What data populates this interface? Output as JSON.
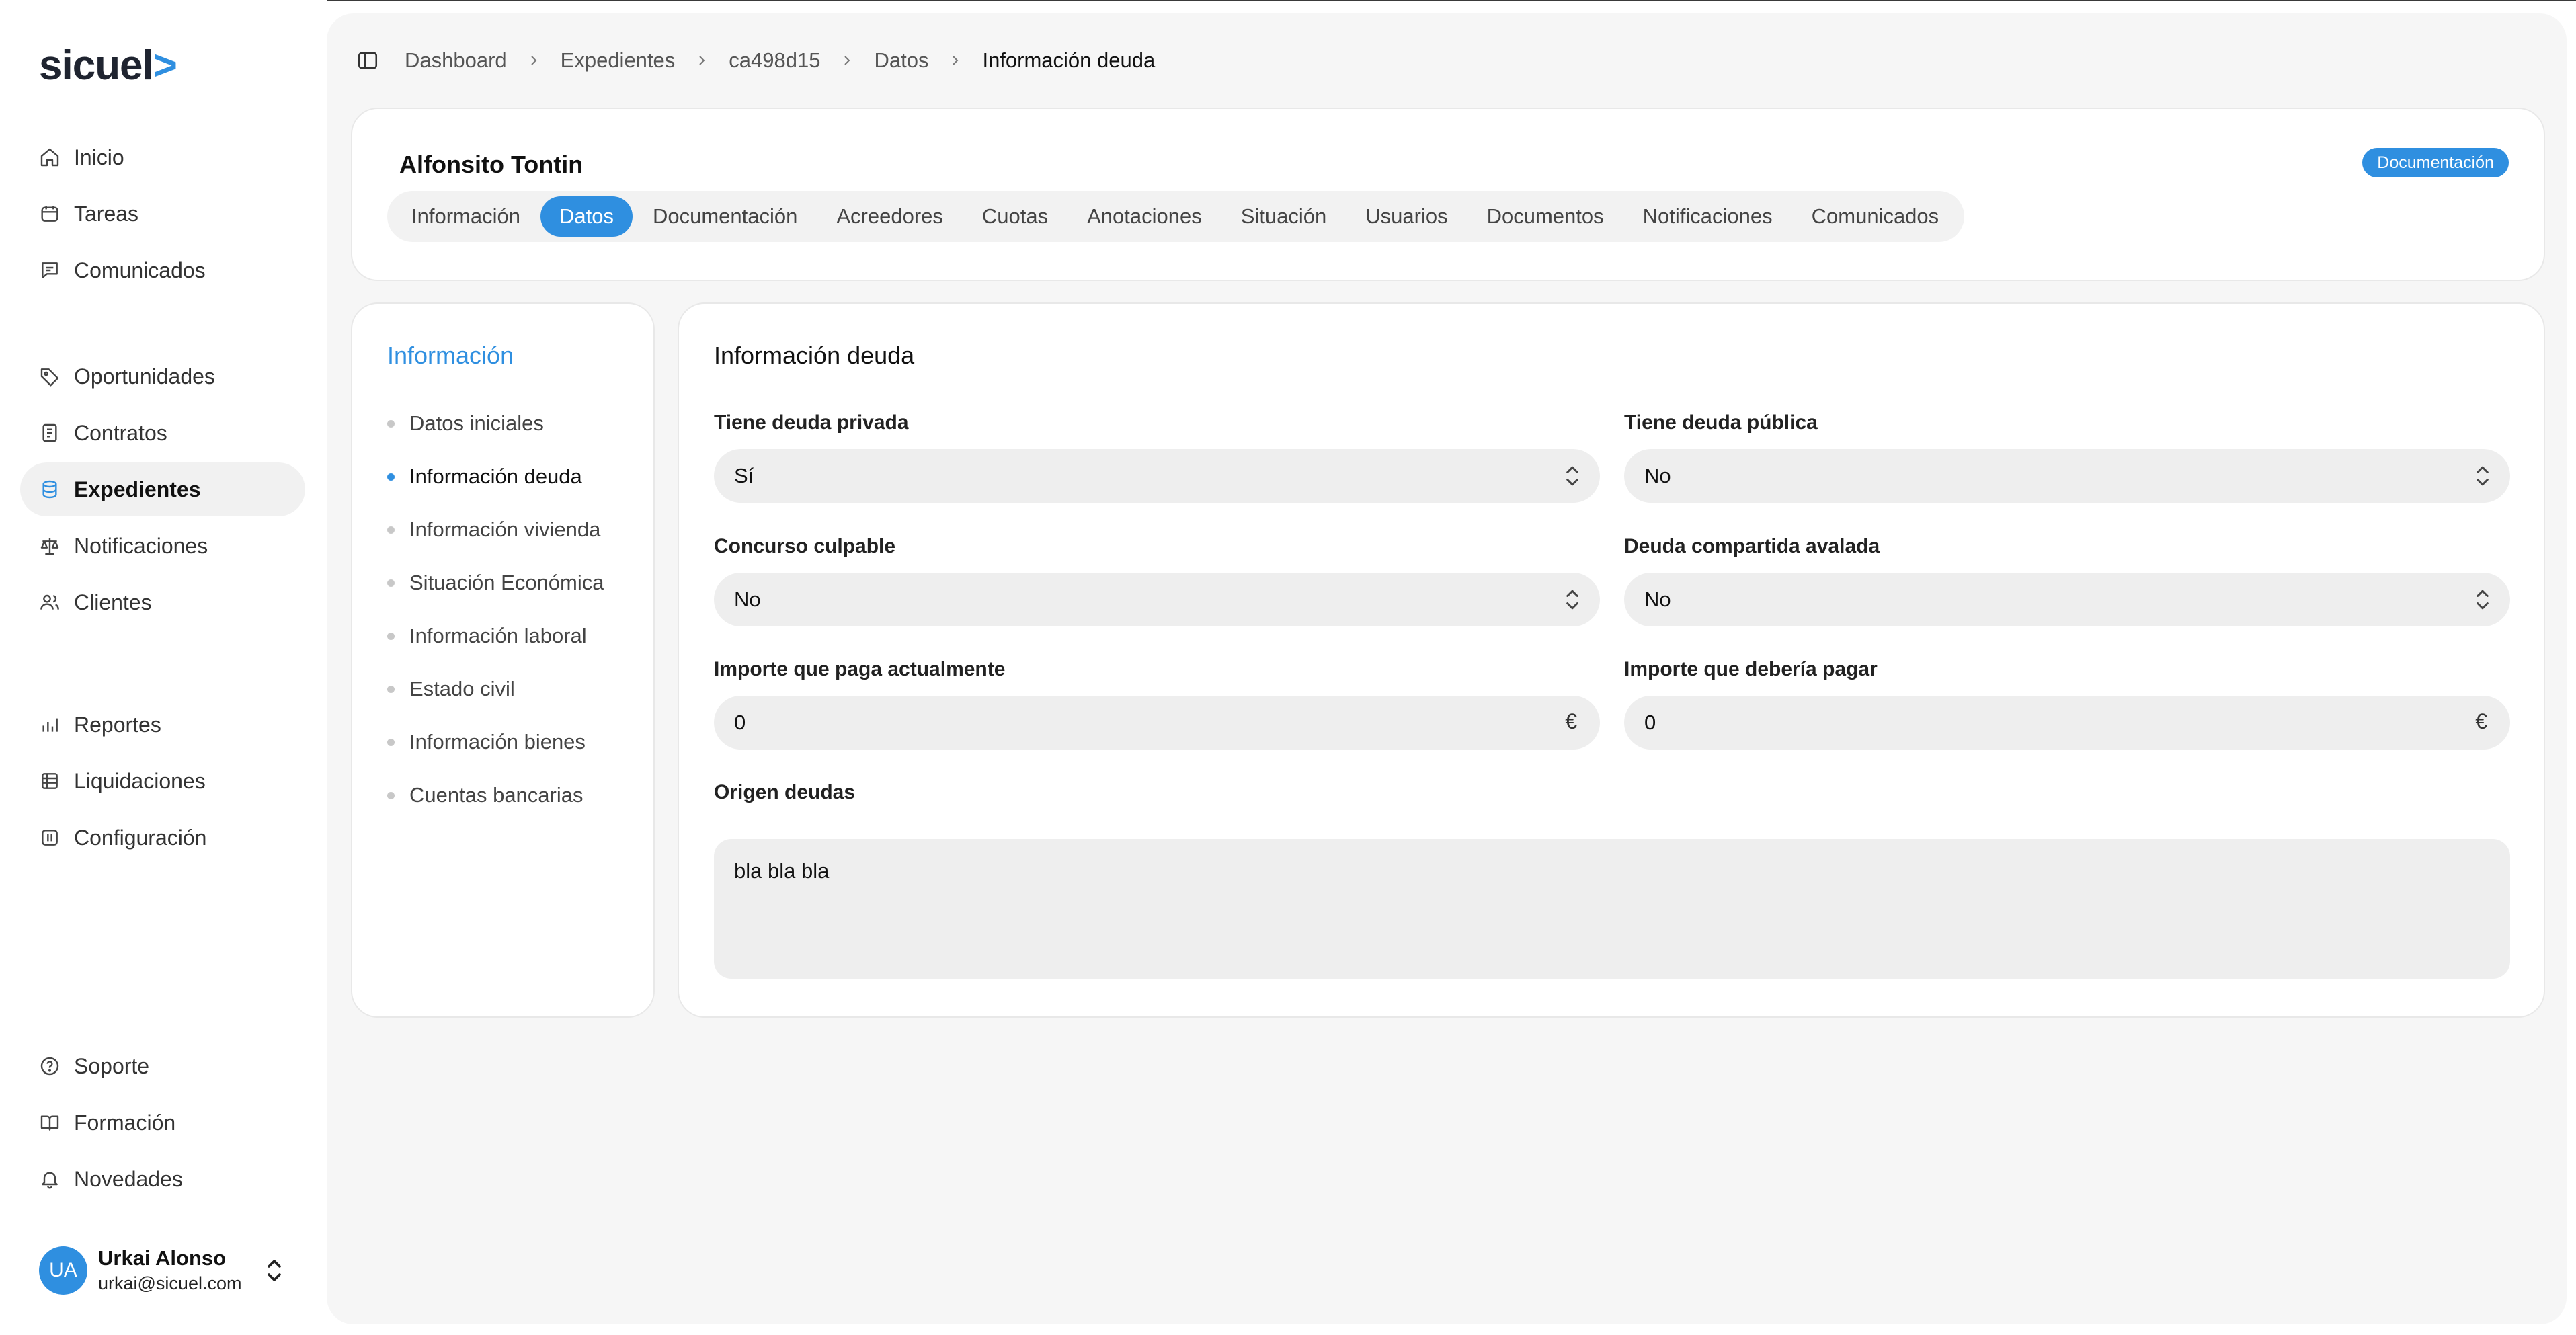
{
  "logo": {
    "text": "sicuel",
    "mark": ">"
  },
  "sidebar": {
    "group1": [
      {
        "label": "Inicio",
        "icon": "home-icon"
      },
      {
        "label": "Tareas",
        "icon": "calendar-icon"
      },
      {
        "label": "Comunicados",
        "icon": "message-icon"
      }
    ],
    "group2": [
      {
        "label": "Oportunidades",
        "icon": "tag-icon"
      },
      {
        "label": "Contratos",
        "icon": "contract-icon"
      },
      {
        "label": "Expedientes",
        "icon": "database-icon",
        "active": true
      },
      {
        "label": "Notificaciones",
        "icon": "scale-icon"
      },
      {
        "label": "Clientes",
        "icon": "users-icon"
      }
    ],
    "group3": [
      {
        "label": "Reportes",
        "icon": "chart-icon"
      },
      {
        "label": "Liquidaciones",
        "icon": "stack-icon"
      },
      {
        "label": "Configuración",
        "icon": "settings-icon"
      }
    ],
    "group4": [
      {
        "label": "Soporte",
        "icon": "help-icon"
      },
      {
        "label": "Formación",
        "icon": "book-icon"
      },
      {
        "label": "Novedades",
        "icon": "bell-icon"
      }
    ]
  },
  "user": {
    "initials": "UA",
    "name": "Urkai Alonso",
    "email": "urkai@sicuel.com"
  },
  "breadcrumb": [
    "Dashboard",
    "Expedientes",
    "ca498d15",
    "Datos",
    "Información deuda"
  ],
  "header": {
    "name": "Alfonsito Tontin",
    "badge": "Documentación",
    "tabs": [
      "Información",
      "Datos",
      "Documentación",
      "Acreedores",
      "Cuotas",
      "Anotaciones",
      "Situación",
      "Usuarios",
      "Documentos",
      "Notificaciones",
      "Comunicados"
    ],
    "active_tab": "Datos"
  },
  "section_nav": {
    "title": "Información",
    "items": [
      "Datos iniciales",
      "Información deuda",
      "Información vivienda",
      "Situación Económica",
      "Información laboral",
      "Estado civil",
      "Información bienes",
      "Cuentas bancarias"
    ],
    "active": "Información deuda"
  },
  "form": {
    "title": "Información deuda",
    "tiene_deuda_privada": {
      "label": "Tiene deuda privada",
      "value": "Sí"
    },
    "tiene_deuda_publica": {
      "label": "Tiene deuda pública",
      "value": "No"
    },
    "concurso_culpable": {
      "label": "Concurso culpable",
      "value": "No"
    },
    "deuda_compartida": {
      "label": "Deuda compartida avalada",
      "value": "No"
    },
    "importe_paga": {
      "label": "Importe que paga actualmente",
      "value": "0",
      "unit": "€"
    },
    "importe_deberia": {
      "label": "Importe que debería pagar",
      "value": "0",
      "unit": "€"
    },
    "origen_deudas": {
      "label": "Origen deudas",
      "value": "bla bla bla"
    }
  },
  "colors": {
    "accent": "#2f8fe0",
    "background": "#f6f6f6",
    "field": "#eeeeee"
  }
}
